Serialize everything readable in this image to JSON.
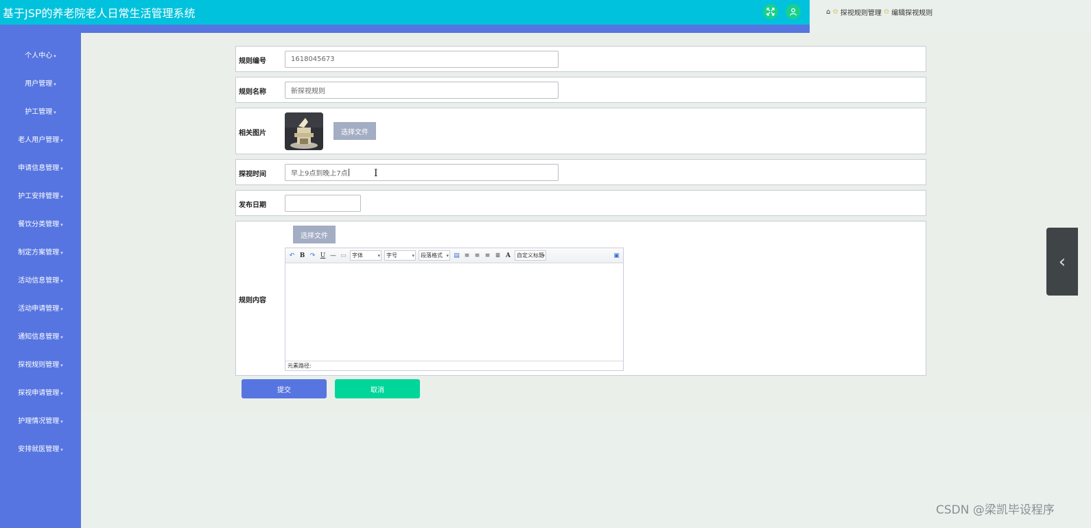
{
  "header": {
    "title": "基于JSP的养老院老人日常生活管理系统",
    "fullscreen_icon": "expand-icon",
    "user_icon": "user-icon"
  },
  "breadcrumb": {
    "home_icon": "home-icon",
    "items": [
      "探视规则管理",
      "编辑探视规则"
    ]
  },
  "sidebar": {
    "items": [
      {
        "label": "个人中心"
      },
      {
        "label": "用户管理"
      },
      {
        "label": "护工管理"
      },
      {
        "label": "老人用户管理"
      },
      {
        "label": "申请信息管理"
      },
      {
        "label": "护工安排管理"
      },
      {
        "label": "餐饮分类管理"
      },
      {
        "label": "制定方案管理"
      },
      {
        "label": "活动信息管理"
      },
      {
        "label": "活动申请管理"
      },
      {
        "label": "通知信息管理"
      },
      {
        "label": "探视规则管理"
      },
      {
        "label": "探视申请管理"
      },
      {
        "label": "护理情况管理"
      },
      {
        "label": "安排就医管理"
      }
    ]
  },
  "form": {
    "rule_no": {
      "label": "规则编号",
      "value": "1618045673"
    },
    "rule_name": {
      "label": "规则名称",
      "value": "新探视规则"
    },
    "image": {
      "label": "相关图片",
      "button": "选择文件"
    },
    "visit_time": {
      "label": "探视时间",
      "value": "早上9点到晚上7点"
    },
    "publish_date": {
      "label": "发布日期",
      "value": ""
    },
    "content": {
      "label": "规则内容",
      "button": "选择文件",
      "toolbar": {
        "font_family": "字体",
        "font_size": "字号",
        "paragraph": "段落格式",
        "custom_title": "自定义标题"
      },
      "footer": "元素路径:"
    }
  },
  "actions": {
    "submit": "提交",
    "cancel": "取消"
  },
  "colors": {
    "header": "#00c2dc",
    "sidebar": "#5675e0",
    "submit": "#5675e0",
    "cancel": "#00d69a"
  },
  "watermark": "CSDN @梁凯毕设程序"
}
